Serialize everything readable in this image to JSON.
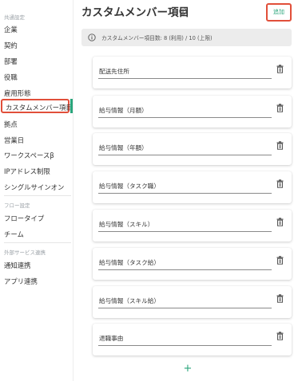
{
  "sidebar": {
    "common_label": "共通設定",
    "common_items": [
      "企業",
      "契約",
      "部署",
      "役職",
      "雇用形態",
      "カスタムメンバー項目",
      "拠点",
      "営業日",
      "ワークスペースβ",
      "IPアドレス制限",
      "シングルサインオン"
    ],
    "selected_item": "カスタムメンバー項目",
    "flow_label": "フロー設定",
    "flow_items": [
      "フロータイプ",
      "チーム"
    ],
    "external_label": "外部サービス連携",
    "external_items": [
      "通知連携",
      "アプリ連携"
    ]
  },
  "header": {
    "title": "カスタムメンバー項目",
    "add_label": "追加"
  },
  "banner": {
    "text": "カスタムメンバー項目数: 8 (利用) / 10 (上限)"
  },
  "fields": [
    "配送先住所",
    "給与情報（月額）",
    "給与情報（年額）",
    "給与情報（タスク職）",
    "給与情報（スキル）",
    "給与情報（タスク給）",
    "給与情報（スキル給）",
    "退職事由"
  ],
  "colors": {
    "accent": "#2aa57b",
    "highlight": "#e14f3a",
    "banner_bg": "#ececec"
  },
  "icons": {
    "title_info": "info-icon",
    "banner_info": "info-icon",
    "row_delete": "trash-icon",
    "add_row": "plus-icon"
  }
}
